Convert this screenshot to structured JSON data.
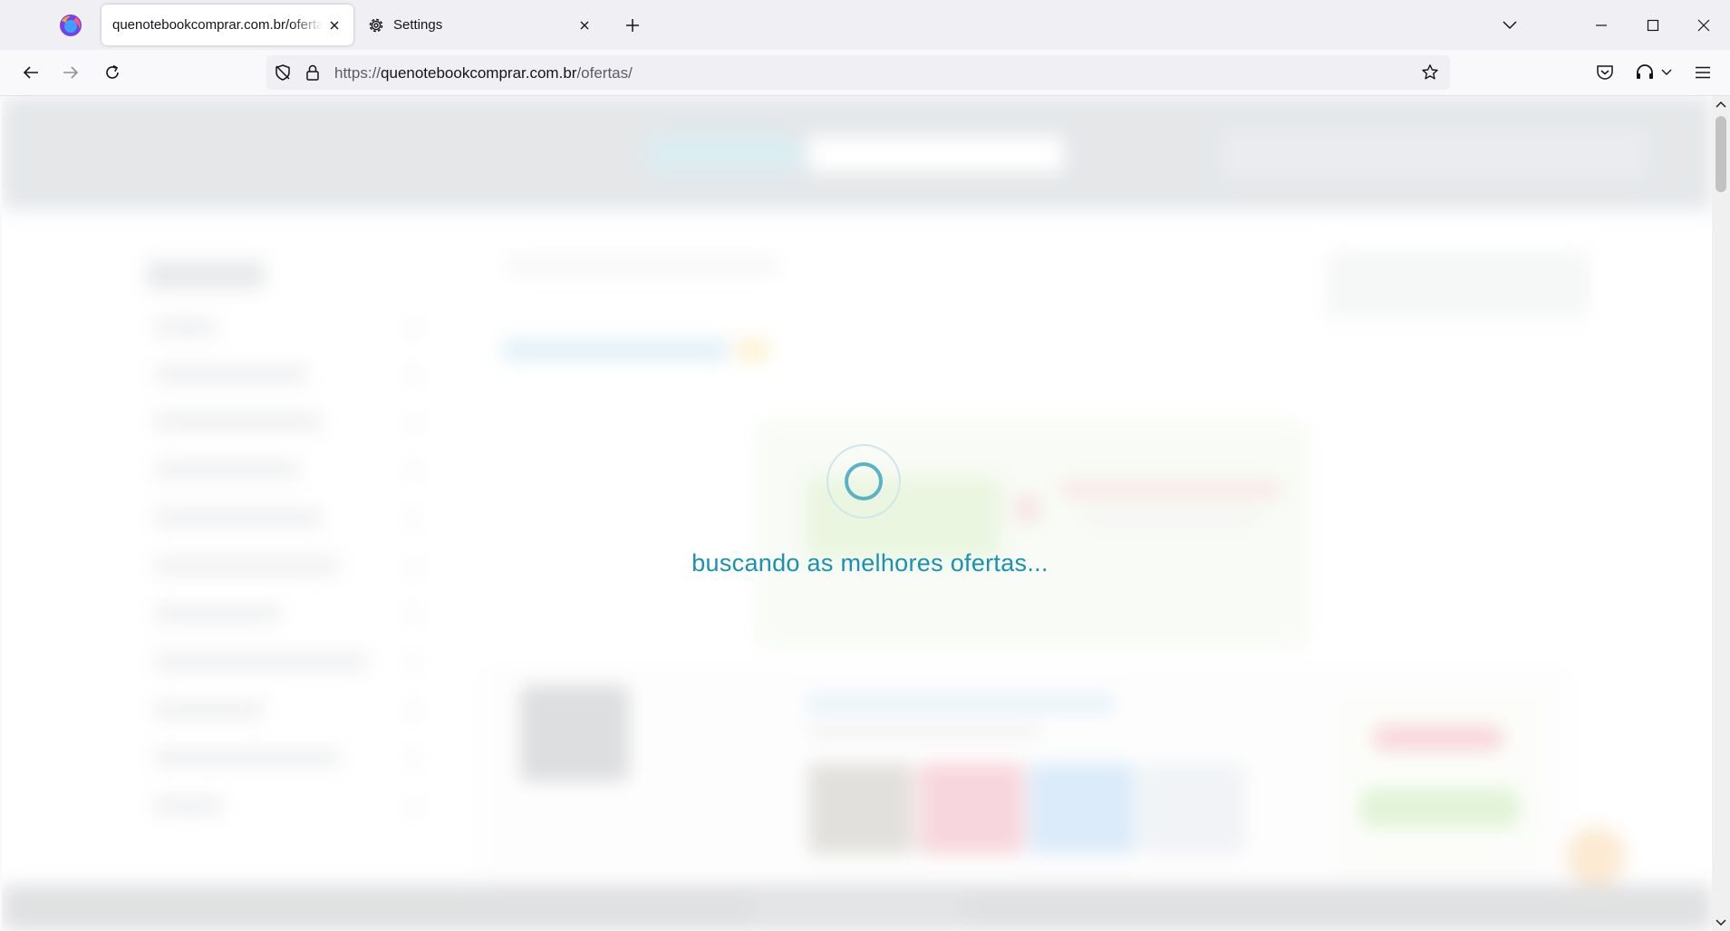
{
  "browser": {
    "tabs": [
      {
        "title": "quenotebookcomprar.com.br/ofertas/",
        "active": true
      },
      {
        "title": "Settings",
        "active": false
      }
    ],
    "url": {
      "scheme": "https://",
      "host": "quenotebookcomprar.com.br",
      "path": "/ofertas/"
    }
  },
  "page": {
    "loading_text": "buscando as melhores ofertas...",
    "loader_color": "#1892b0"
  },
  "icons": {
    "browser_logo": "firefox-logo-icon",
    "tab_close": "close-icon",
    "settings": "gear-icon",
    "new_tab": "plus-icon",
    "tab_list": "chevron-down-icon",
    "back": "arrow-left-icon",
    "forward": "arrow-right-icon",
    "reload": "reload-icon",
    "tracking": "shield-icon",
    "secure": "lock-icon",
    "bookmark": "star-icon",
    "pocket": "pocket-icon",
    "extensions": "headphones-icon",
    "menu": "hamburger-icon"
  }
}
